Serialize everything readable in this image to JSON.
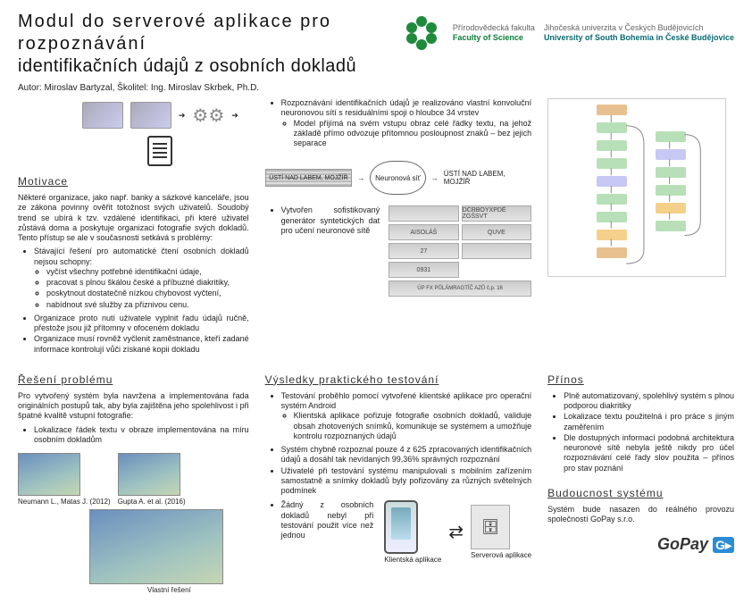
{
  "header": {
    "title_line1": "Modul do serverové aplikace pro rozpoznávání",
    "title_line2": "identifikačních údajů z osobních dokladů",
    "author": "Autor: Miroslav Bartyzal, Školitel: Ing. Miroslav Skrbek, Ph.D.",
    "faculty_cz": "Přírodovědecká fakulta",
    "faculty_en": "Faculty of Science",
    "univ_cz": "Jihočeská univerzita v Českých Budějovicích",
    "univ_en": "University of South Bohemia in České Budějovice"
  },
  "motivace": {
    "title": "Motivace",
    "p1": "Některé organizace, jako např. banky a sázkové kanceláře, jsou ze zákona povinny ověřit totožnost svých uživatelů. Soudobý trend se ubírá k tzv. vzdálené identifikaci, při které uživatel zůstává doma a poskytuje organizaci fotografie svých dokladů. Tento přístup se ale v současnosti setkává s problémy:",
    "b1": "Stávající řešení pro automatické čtení osobních dokladů nejsou schopny:",
    "s1": "vyčíst všechny potřebné identifikační údaje,",
    "s2": "pracovat s plnou škálou české a příbuzné diakritiky,",
    "s3": "poskytnout dostatečně nízkou chybovost vyčtení,",
    "s4": "nabídnout své služby za přiznivou cenu.",
    "b2": "Organizace proto nutí uživatele vyplnit řadu údajů ručně, přestože jsou již přítomny v ofoceném dokladu",
    "b3": "Organizace musí rovněž vyčlenit zaměstnance, kteří zadané informace kontrolují vůči získané kopii dokladu"
  },
  "topmid": {
    "b1": "Rozpoznávání identifikačních údajů je realizováno vlastní konvoluční neuronovou sítí s residuálními spoji o hloubce 34 vrstev",
    "s1": "Model přijímá na svém vstupu obraz celé řádky textu, na jehož základě přímo odvozuje přítomnou posloupnost znaků – bez jejich separace",
    "nn_label": "Neuronová síť",
    "nn_in": "ÚSTÍ NAD LABEM, MOJŽÍŘ",
    "nn_out": "ÚSTÍ NAD LABEM, MOJŽÍŘ",
    "b2": "Vytvořen sofistikovaný generátor syntetických dat pro učení neuronové sítě",
    "syn1": "DČRBOYXPDĚ ZGŠSVT",
    "syn2": "QUVE",
    "syn3": "AISOLÁŠ",
    "syn4": "27",
    "syn5": "ÚP FX PŮLÁMRAGTÍČ AZŮ č.p. 16",
    "syn6": "0931"
  },
  "reseni": {
    "title": "Řešení problému",
    "p1": "Pro vytvořený systém byla navržena a implementována řada originálních postupů tak, aby byla zajištěna jeho spolehlivost i při špatné kvalitě vstupní fotografie:",
    "b1": "Lokalizace řádek textu v obraze implementována na míru osobním dokladům",
    "cap1": "Neumann L., Matas J. (2012)",
    "cap2": "Gupta A. et al. (2016)",
    "cap3": "Vlastní řešení"
  },
  "vysledky": {
    "title": "Výsledky praktického testování",
    "b1": "Testování proběhlo pomocí vytvořené klientské aplikace pro operační systém Android",
    "s1": "Klientská aplikace pořizuje fotografie osobních dokladů, validuje obsah zhotovených snímků, komunikuje se systémem a umožňuje kontrolu rozpoznaných údajů",
    "b2": "Systém chybně rozpoznal pouze 4 z 625 zpracovaných identifikačních údajů a dosáhl tak nevídaných 99,36% správných rozpoznání",
    "b3": "Uživatelé při testování systému manipulovali s mobilním zařízením samostatně a snímky dokladů byly pořizovány za různých světelných podmínek",
    "b4": "Žádný z osobních dokladů nebyl při testování použit více než jednou",
    "cap_client": "Klientská aplikace",
    "cap_server": "Serverová aplikace"
  },
  "prinos": {
    "title": "Přínos",
    "b1": "Plně automatizovaný, spolehlivý systém s plnou podporou diakritiky",
    "b2": "Lokalizace textu použitelná i pro práce s jiným zaměřením",
    "b3": "Dle dostupných informací podobná architektura neuronové sítě nebyla ještě nikdy pro účel rozpoznávání celé řady slov použita – přínos pro stav poznání"
  },
  "budoucnost": {
    "title": "Budoucnost systému",
    "p1": "Systém bude nasazen do reálného provozu společností GoPay s.r.o.",
    "brand": "GoPay"
  }
}
